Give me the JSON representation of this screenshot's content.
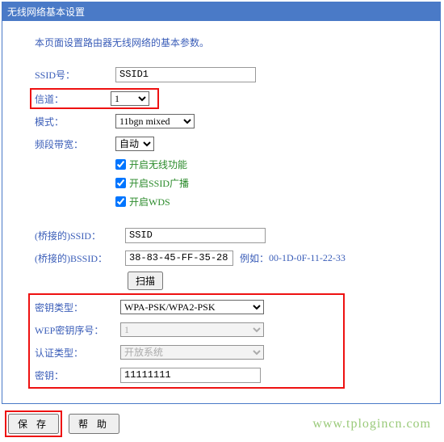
{
  "title": "无线网络基本设置",
  "intro": "本页面设置路由器无线网络的基本参数。",
  "fields": {
    "ssid_label": "SSID号：",
    "ssid_value": "SSID1",
    "channel_label": "信道：",
    "channel_value": "1",
    "mode_label": "模式：",
    "mode_value": "11bgn mixed",
    "bandwidth_label": "频段带宽：",
    "bandwidth_value": "自动"
  },
  "checkboxes": {
    "enable_wireless": "开启无线功能",
    "enable_ssid_broadcast": "开启SSID广播",
    "enable_wds": "开启WDS"
  },
  "bridge": {
    "ssid_label": "(桥接的)SSID：",
    "ssid_value": "SSID",
    "bssid_label": "(桥接的)BSSID：",
    "bssid_value": "38-83-45-FF-35-28",
    "example_label": "例如：",
    "example_value": "00-1D-0F-11-22-33",
    "scan_btn": "扫描"
  },
  "security": {
    "keytype_label": "密钥类型：",
    "keytype_value": "WPA-PSK/WPA2-PSK",
    "wepidx_label": "WEP密钥序号：",
    "wepidx_value": "1",
    "authtype_label": "认证类型：",
    "authtype_value": "开放系统",
    "key_label": "密钥：",
    "key_value": "11111111"
  },
  "buttons": {
    "save": "保 存",
    "help": "帮 助"
  },
  "watermark": "www.tplogincn.com"
}
